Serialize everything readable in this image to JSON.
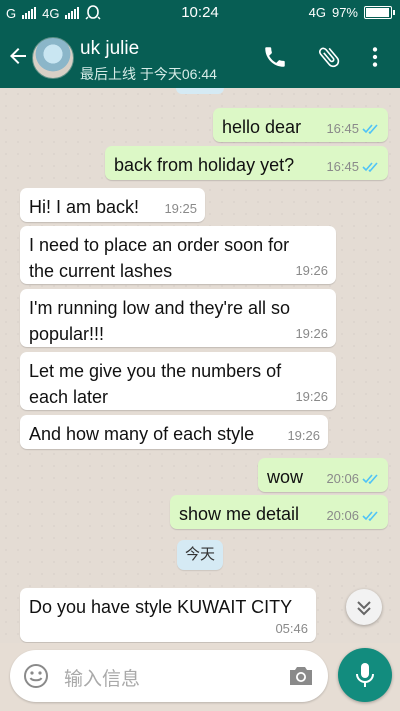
{
  "status_bar": {
    "carrier_1": "G",
    "carrier_2": "4G",
    "time": "10:24",
    "network": "4G",
    "battery": "97%",
    "battery_level": 0.97
  },
  "header": {
    "contact_name": "uk julie",
    "last_seen": "最后上线 于今天06:44",
    "call_icon": "phone-icon",
    "attach_icon": "paperclip-icon",
    "menu_icon": "more-vert-icon"
  },
  "messages": [
    {
      "direction": "out",
      "text": "hello dear",
      "time": "16:45",
      "status": "read"
    },
    {
      "direction": "out",
      "text": "back from holiday yet?",
      "time": "16:45",
      "status": "read"
    },
    {
      "direction": "in",
      "text": "Hi! I am back!",
      "time": "19:25"
    },
    {
      "direction": "in",
      "text_line1": "I need to place an order soon for",
      "text_line2": "the current lashes",
      "time": "19:26"
    },
    {
      "direction": "in",
      "text_line1": "I'm running low and they're all so",
      "text_line2": "popular!!!",
      "time": "19:26"
    },
    {
      "direction": "in",
      "text_line1": "Let me give you the numbers of",
      "text_line2": "each later",
      "time": "19:26"
    },
    {
      "direction": "in",
      "text": "And how many of each style",
      "time": "19:26"
    },
    {
      "direction": "out",
      "text": "wow",
      "time": "20:06",
      "status": "read"
    },
    {
      "direction": "out",
      "text": "show me detail",
      "time": "20:06",
      "status": "read"
    },
    {
      "direction": "in",
      "text": "Do you have style KUWAIT CITY",
      "time": "05:46"
    }
  ],
  "day_separator": "今天",
  "composer": {
    "placeholder": "输入信息",
    "emoji_icon": "emoji-icon",
    "camera_icon": "camera-icon",
    "mic_icon": "mic-icon"
  },
  "colors": {
    "header": "#075e54",
    "outgoing_bubble": "#dcf8c6",
    "incoming_bubble": "#ffffff",
    "read_ticks": "#4fc3f7",
    "mic_button": "#128c7e"
  }
}
